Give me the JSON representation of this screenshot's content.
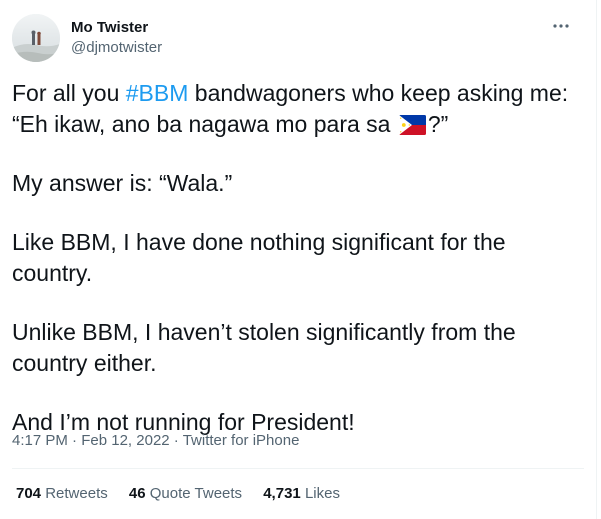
{
  "author": {
    "display_name": "Mo Twister",
    "handle": "@djmotwister"
  },
  "tweet": {
    "line1_prefix": "For all you ",
    "hashtag": "#BBM",
    "line1_suffix": " bandwagoners who keep asking me:",
    "line2_prefix": "“Eh ikaw, ano ba nagawa mo para sa ",
    "line2_suffix": "?”",
    "p2": "My answer is: “Wala.”",
    "p3_line1": "Like BBM, I have done nothing significant for the",
    "p3_line2": "country.",
    "p4_line1": "Unlike BBM, I haven’t stolen significantly from the",
    "p4_line2": "country either.",
    "p5": "And I’m not running for President!",
    "flag_icon": "philippines-flag-icon"
  },
  "meta": {
    "time": "4:17 PM",
    "separator": "·",
    "date": "Feb 12, 2022",
    "source": "Twitter for iPhone"
  },
  "stats": {
    "retweets_count": "704",
    "retweets_label": "Retweets",
    "quotes_count": "46",
    "quotes_label": "Quote Tweets",
    "likes_count": "4,731",
    "likes_label": "Likes"
  },
  "colors": {
    "accent": "#1d9bf0",
    "text_primary": "#0f1419",
    "text_secondary": "#536471",
    "divider": "#eff3f4"
  },
  "icons": {
    "more": "more-options-icon",
    "avatar": "avatar"
  }
}
